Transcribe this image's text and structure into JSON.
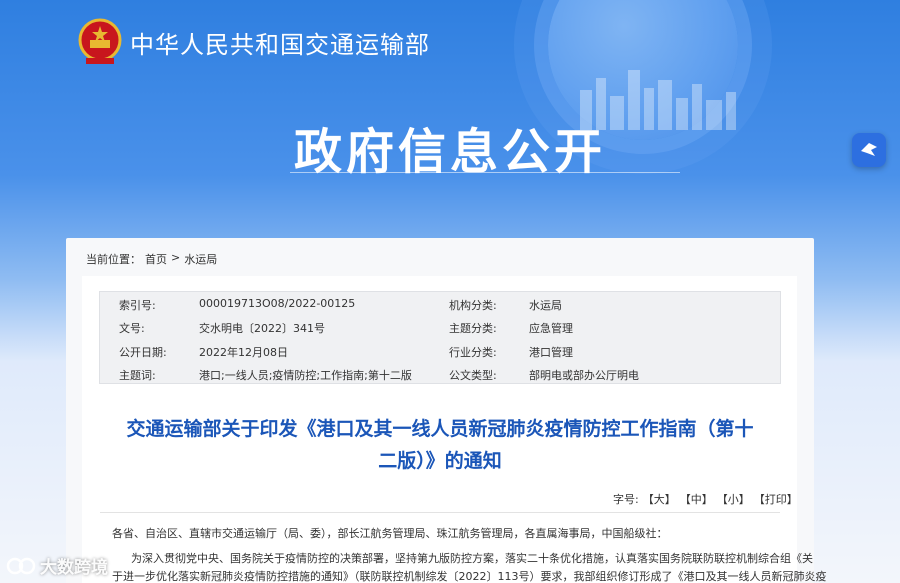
{
  "header": {
    "ministry_name": "中华人民共和国交通运输部",
    "page_title": "政府信息公开"
  },
  "breadcrumb": {
    "prefix": "当前位置：",
    "home": "首页",
    "separator": ">",
    "current": "水运局"
  },
  "info": {
    "index_label": "索引号:",
    "index_value": "000019713O08/2022-00125",
    "category_label": "机构分类:",
    "category_value": "水运局",
    "doc_no_label": "文号:",
    "doc_no_value": "交水明电〔2022〕341号",
    "topic_label": "主题分类:",
    "topic_value": "应急管理",
    "date_label": "公开日期:",
    "date_value": "2022年12月08日",
    "industry_label": "行业分类:",
    "industry_value": "港口管理",
    "keywords_label": "主题词:",
    "keywords_value": "港口;一线人员;疫情防控;工作指南;第十二版",
    "doc_type_label": "公文类型:",
    "doc_type_value": "部明电或部办公厅明电"
  },
  "document": {
    "title_line1": "交通运输部关于印发《港口及其一线人员新冠肺炎疫情防控工作指南（第十",
    "title_line2": "二版）》的通知",
    "recipients": "各省、自治区、直辖市交通运输厅（局、委），部长江航务管理局、珠江航务管理局，各直属海事局，中国船级社：",
    "body_line1": "为深入贯彻党中央、国务院关于疫情防控的决策部署，坚持第九版防控方案，落实二十条优化措施，认真落实国务院联防联控机制综合组《关",
    "body_line2": "于进一步优化落实新冠肺炎疫情防控措施的通知》（联防联控机制综发〔2022〕113号）要求，我部组织修订形成了《港口及其一线人员新冠肺炎疫"
  },
  "font_size": {
    "label": "字号:",
    "large": "【大】",
    "medium": "【中】",
    "small": "【小】",
    "print": "【打印】"
  },
  "watermark": {
    "text": "大数跨境"
  },
  "colors": {
    "header_blue": "#2f7fe0",
    "title_blue": "#1b56b8"
  }
}
